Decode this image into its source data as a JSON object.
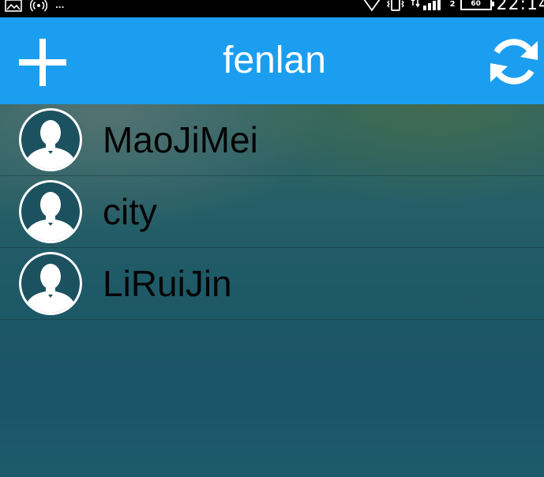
{
  "app": {
    "title": "fenlan"
  },
  "status_bar": {
    "time": "22:14",
    "signal_label": "2",
    "battery_label": "60",
    "left_text": "..."
  },
  "toolbar": {
    "add_icon": "plus-icon",
    "refresh_icon": "refresh-icon"
  },
  "contacts": [
    {
      "name": "MaoJiMei",
      "icon": "person-avatar-icon"
    },
    {
      "name": "city",
      "icon": "person-avatar-icon"
    },
    {
      "name": "LiRuiJin",
      "icon": "person-avatar-icon"
    }
  ],
  "colors": {
    "app_bar": "#1b9ef0",
    "status_bar": "#000000",
    "title_text": "#ffffff",
    "item_text": "#050505"
  }
}
